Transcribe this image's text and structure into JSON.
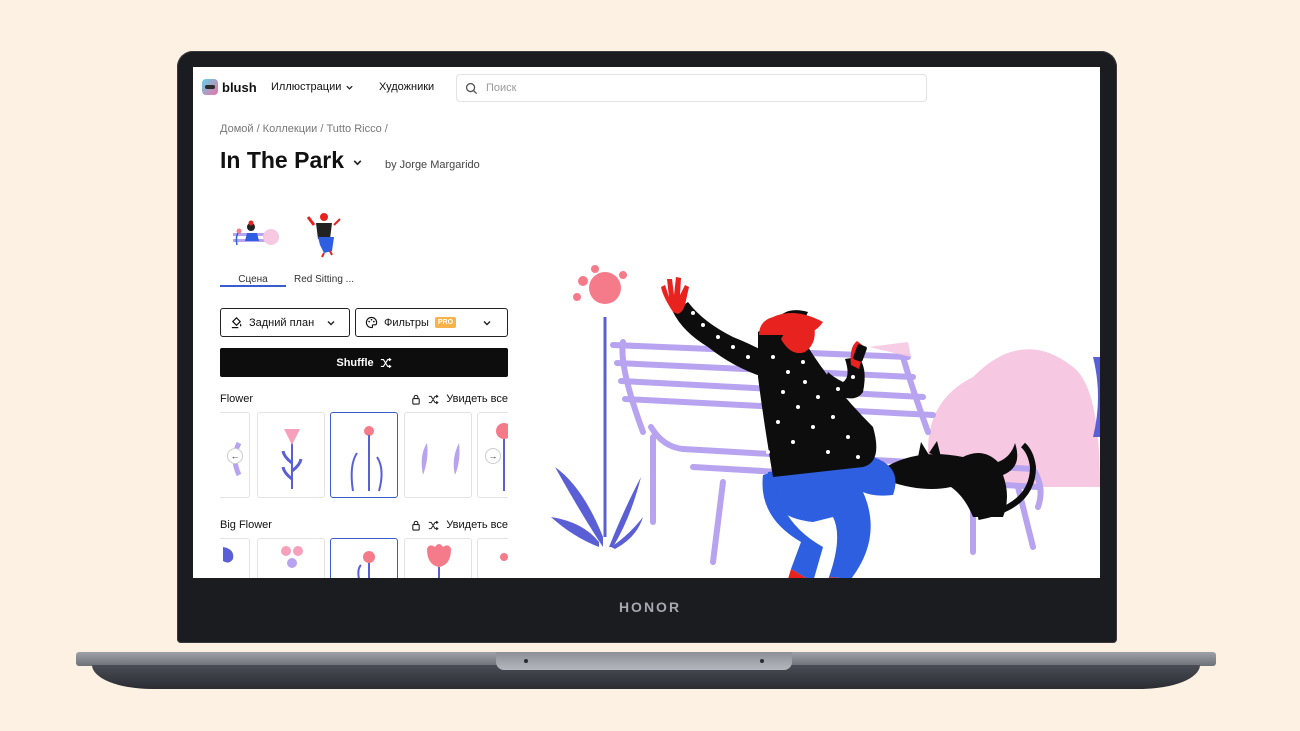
{
  "device": {
    "brand": "HONOR"
  },
  "header": {
    "logo": "blush",
    "nav": [
      {
        "label": "Иллюстрации",
        "has_dropdown": true
      },
      {
        "label": "Художники",
        "has_dropdown": false
      }
    ],
    "search": {
      "placeholder": "Поиск",
      "value": ""
    }
  },
  "breadcrumb": "Домой / Коллекции / Tutto Ricco /",
  "page": {
    "title": "In The Park",
    "author": "by Jorge Margarido"
  },
  "scene_tabs": [
    {
      "label": "Сцена",
      "active": true
    },
    {
      "label": "Red Sitting ...",
      "active": false
    }
  ],
  "controls": {
    "background_label": "Задний план",
    "filters_label": "Фильтры",
    "filters_badge": "PRO",
    "shuffle_label": "Shuffle"
  },
  "sections": [
    {
      "name": "Flower",
      "see_all": "Увидеть все"
    },
    {
      "name": "Big Flower",
      "see_all": "Увидеть все"
    }
  ],
  "colors": {
    "accent": "#3b5ccc",
    "red": "#e8231f",
    "blue": "#2d5fe0",
    "lavender": "#b7a3ef",
    "pink": "#f6c8e2"
  }
}
